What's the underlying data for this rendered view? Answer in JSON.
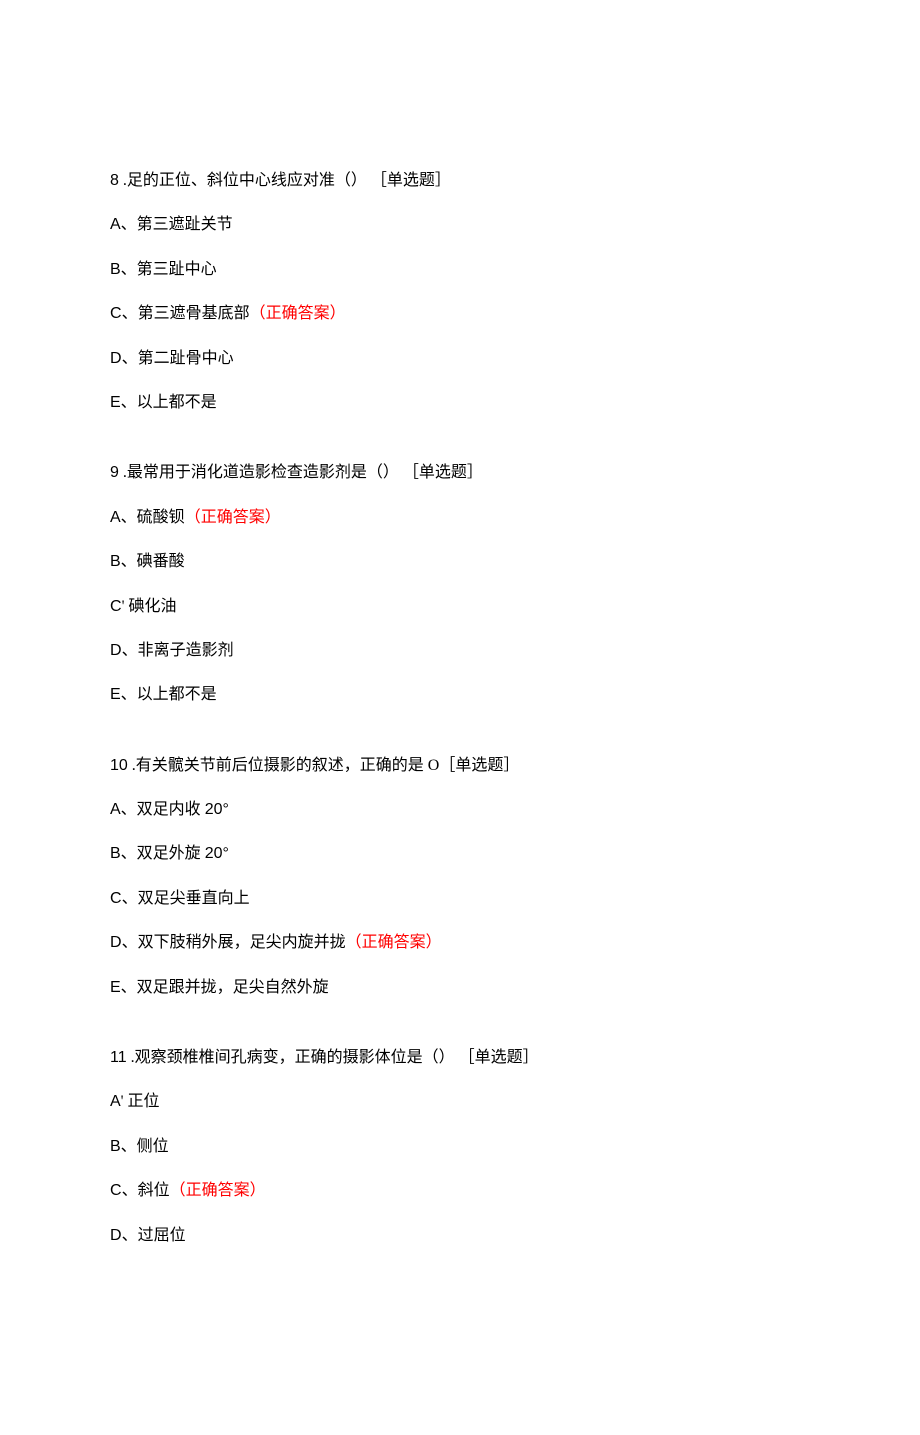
{
  "questions": [
    {
      "number": "8",
      "stem": " .足的正位、斜位中心线应对准（） ［单选题］",
      "options": [
        {
          "label": "A、第三遮趾关节",
          "correct": false,
          "prefix_style": "latin"
        },
        {
          "label": "B、第三趾中心",
          "correct": false,
          "prefix_style": "latin"
        },
        {
          "label": "C、第三遮骨基底部",
          "correct": true,
          "prefix_style": "latin"
        },
        {
          "label": "D、第二趾骨中心",
          "correct": false,
          "prefix_style": "latin"
        },
        {
          "label": "E、以上都不是",
          "correct": false,
          "prefix_style": "latin"
        }
      ]
    },
    {
      "number": "9",
      "stem": " .最常用于消化道造影检查造影剂是（） ［单选题］",
      "options": [
        {
          "label": "A、硫酸钡",
          "correct": true,
          "prefix_style": "latin"
        },
        {
          "label": "B、碘番酸",
          "correct": false,
          "prefix_style": "latin"
        },
        {
          "label": "C' 碘化油",
          "correct": false,
          "prefix_style": "latin"
        },
        {
          "label": "D、非离子造影剂",
          "correct": false,
          "prefix_style": "latin"
        },
        {
          "label": "E、以上都不是",
          "correct": false,
          "prefix_style": "latin"
        }
      ]
    },
    {
      "number": "10",
      "stem": " .有关髋关节前后位摄影的叙述，正确的是 O［单选题］",
      "options": [
        {
          "label": "A、双足内收 ",
          "suffix": "20°",
          "correct": false,
          "prefix_style": "latin"
        },
        {
          "label": "B、双足外旋 ",
          "suffix": "20°",
          "correct": false,
          "prefix_style": "latin"
        },
        {
          "label": "C、双足尖垂直向上",
          "correct": false,
          "prefix_style": "latin"
        },
        {
          "label": "D、双下肢稍外展，足尖内旋并拢",
          "correct": true,
          "prefix_style": "latin"
        },
        {
          "label": "E、双足跟并拢，足尖自然外旋",
          "correct": false,
          "prefix_style": "latin"
        }
      ]
    },
    {
      "number": "11",
      "stem": " .观察颈椎椎间孔病变，正确的摄影体位是（） ［单选题］",
      "options": [
        {
          "label": "A' 正位",
          "correct": false,
          "prefix_style": "latin"
        },
        {
          "label": "B、侧位",
          "correct": false,
          "prefix_style": "latin"
        },
        {
          "label": "C、斜位",
          "correct": true,
          "prefix_style": "latin"
        },
        {
          "label": "D、过屈位",
          "correct": false,
          "prefix_style": "latin"
        }
      ]
    }
  ],
  "correct_marker": "（正确答案）"
}
